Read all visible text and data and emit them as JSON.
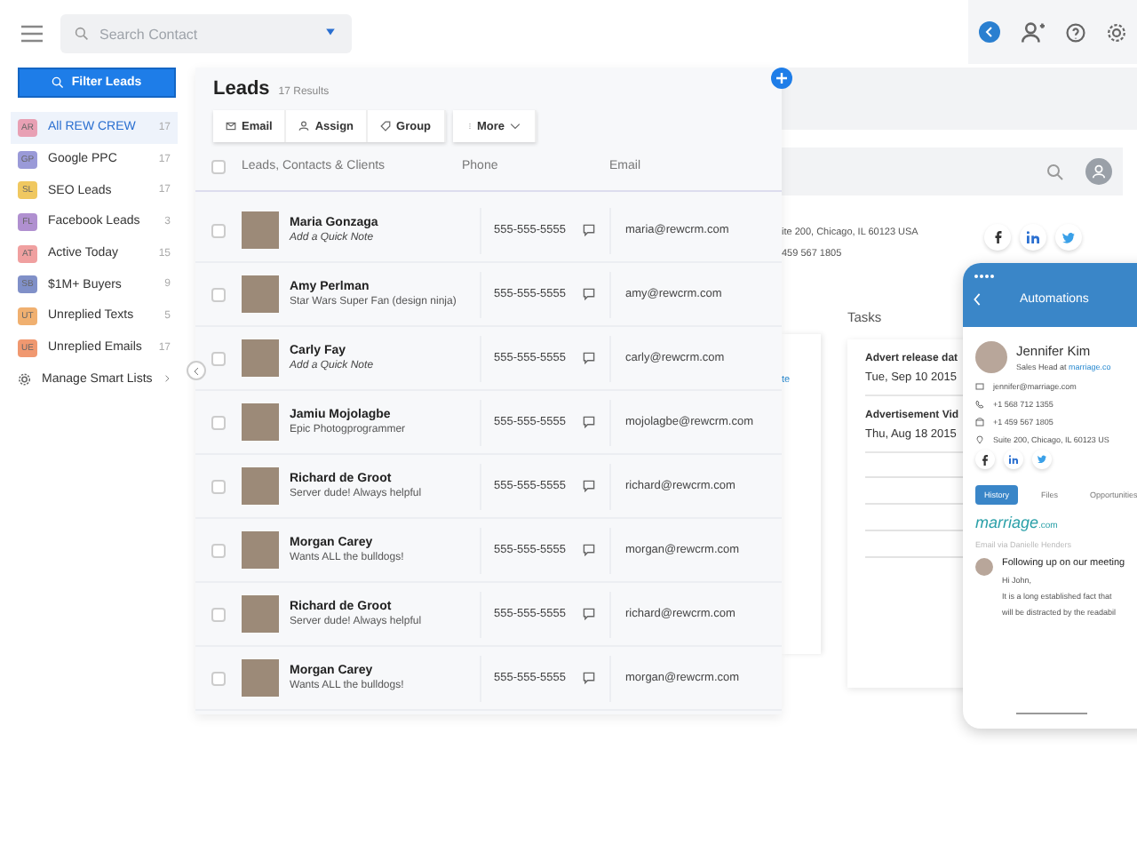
{
  "search": {
    "placeholder": "Search Contact"
  },
  "filter_button": "Filter Leads",
  "sidebar": {
    "items": [
      {
        "kind": "list",
        "badge": "AR",
        "color": "#e8a0b4",
        "label": "All REW CREW",
        "count": "17",
        "selected": true
      },
      {
        "kind": "list",
        "badge": "GP",
        "color": "#9a9ad8",
        "label": "Google PPC",
        "count": "17",
        "selected": false
      },
      {
        "kind": "list",
        "badge": "SL",
        "color": "#f0c860",
        "label": "SEO Leads",
        "count": "17",
        "selected": false
      },
      {
        "kind": "list",
        "badge": "FL",
        "color": "#b090d0",
        "label": "Facebook Leads",
        "count": "3",
        "selected": false
      },
      {
        "kind": "list",
        "badge": "AT",
        "color": "#f0a0a0",
        "label": "Active Today",
        "count": "15",
        "selected": false
      },
      {
        "kind": "list",
        "badge": "SB",
        "color": "#8090c8",
        "label": "$1M+ Buyers",
        "count": "9",
        "selected": false
      },
      {
        "kind": "list",
        "badge": "UT",
        "color": "#f0b070",
        "label": "Unreplied Texts",
        "count": "5",
        "selected": false
      },
      {
        "kind": "list",
        "badge": "UE",
        "color": "#f09870",
        "label": "Unreplied Emails",
        "count": "17",
        "selected": false
      },
      {
        "kind": "manage",
        "label": "Manage Smart Lists",
        "selected": false
      }
    ]
  },
  "leads": {
    "title": "Leads",
    "results": "17 Results",
    "actions": [
      {
        "kind": "email",
        "label": "Email"
      },
      {
        "kind": "assign",
        "label": "Assign"
      },
      {
        "kind": "group",
        "label": "Group"
      },
      {
        "kind": "more",
        "label": "More"
      }
    ],
    "columns": [
      "Leads, Contacts & Clients",
      "Phone",
      "Email"
    ],
    "select_all": {
      "checked": false
    },
    "rows": [
      {
        "name": "Maria Gonzaga",
        "note": "Add a Quick Note",
        "note_prompt": true,
        "phone": "555-555-5555",
        "email": "maria@rewcrm.com",
        "checked": false
      },
      {
        "name": "Amy Perlman",
        "note": "Star Wars Super Fan (design ninja)",
        "note_prompt": false,
        "phone": "555-555-5555",
        "email": "amy@rewcrm.com",
        "checked": false
      },
      {
        "name": "Carly Fay",
        "note": "Add a Quick Note",
        "note_prompt": true,
        "phone": "555-555-5555",
        "email": "carly@rewcrm.com",
        "checked": false
      },
      {
        "name": "Jamiu Mojolagbe",
        "note": "Epic Photogprogrammer",
        "note_prompt": false,
        "phone": "555-555-5555",
        "email": "mojolagbe@rewcrm.com",
        "checked": false
      },
      {
        "name": "Richard de Groot",
        "note": "Server dude! Always helpful",
        "note_prompt": false,
        "phone": "555-555-5555",
        "email": "richard@rewcrm.com",
        "checked": false
      },
      {
        "name": "Morgan Carey",
        "note": "Wants ALL the bulldogs!",
        "note_prompt": false,
        "phone": "555-555-5555",
        "email": "morgan@rewcrm.com",
        "checked": false
      },
      {
        "name": "Richard de Groot",
        "note": "Server dude! Always helpful",
        "note_prompt": false,
        "phone": "555-555-5555",
        "email": "richard@rewcrm.com",
        "checked": false
      },
      {
        "name": "Morgan Carey",
        "note": "Wants ALL the bulldogs!",
        "note_prompt": false,
        "phone": "555-555-5555",
        "email": "morgan@rewcrm.com",
        "checked": false
      }
    ]
  },
  "background": {
    "address": "ite 200, Chicago, IL 60123 USA",
    "phone": "459 567 1805",
    "link": "te",
    "tasks_title": "Tasks",
    "tasks": [
      {
        "title": "Advert release dat",
        "date": "Tue, Sep 10 2015"
      },
      {
        "title": "Advertisement Vid",
        "date": "Thu, Aug 18 2015"
      }
    ]
  },
  "phone": {
    "title": "Automations",
    "contact": {
      "name": "Jennifer Kim",
      "role": "Sales Head at ",
      "company": "marriage.co"
    },
    "details": [
      {
        "kind": "email",
        "text": "jennifer@marriage.com"
      },
      {
        "kind": "mobile",
        "text": "+1 568 712 1355"
      },
      {
        "kind": "phone",
        "text": "+1 459 567 1805"
      },
      {
        "kind": "address",
        "text": "Suite 200, Chicago, IL 60123 US"
      }
    ],
    "tabs": [
      {
        "label": "History",
        "selected": true
      },
      {
        "label": "Files",
        "selected": false
      },
      {
        "label": "Opportunities",
        "selected": false
      }
    ],
    "logo": {
      "word": "marriage",
      "suffix": ".com"
    },
    "via": "Email via Danielle Henders",
    "message": {
      "subject": "Following up on our meeting",
      "lines": [
        "Hi John,",
        "It is a long established fact that",
        "will be distracted by the readabil"
      ]
    }
  }
}
